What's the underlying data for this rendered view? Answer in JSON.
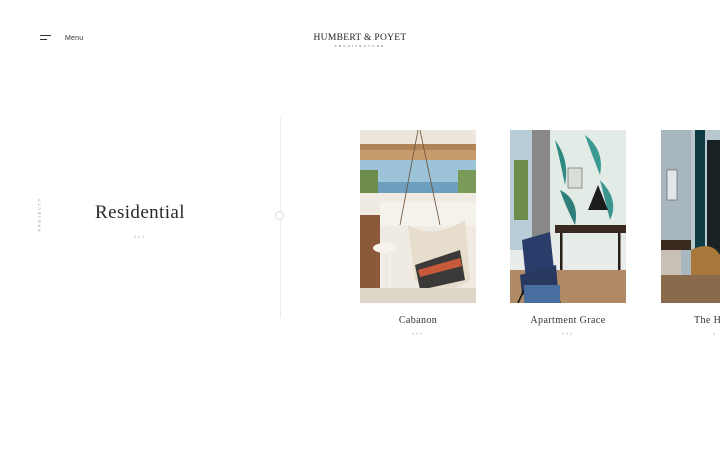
{
  "header": {
    "menu_label": "Menu",
    "logo_name": "HUMBERT & POYET",
    "logo_sub": "ARCHITECTURE"
  },
  "section": {
    "vertical_label": "PROJECTS",
    "title": "Residential",
    "subtitle": "001"
  },
  "projects": [
    {
      "title": "Cabanon",
      "number": "001"
    },
    {
      "title": "Apartment Grace",
      "number": "002"
    },
    {
      "title": "The H",
      "number": "0"
    }
  ],
  "colors": {
    "background": "#ffffff",
    "text": "#2b2b2b",
    "muted": "#aaaaaa",
    "divider": "#ececec"
  }
}
